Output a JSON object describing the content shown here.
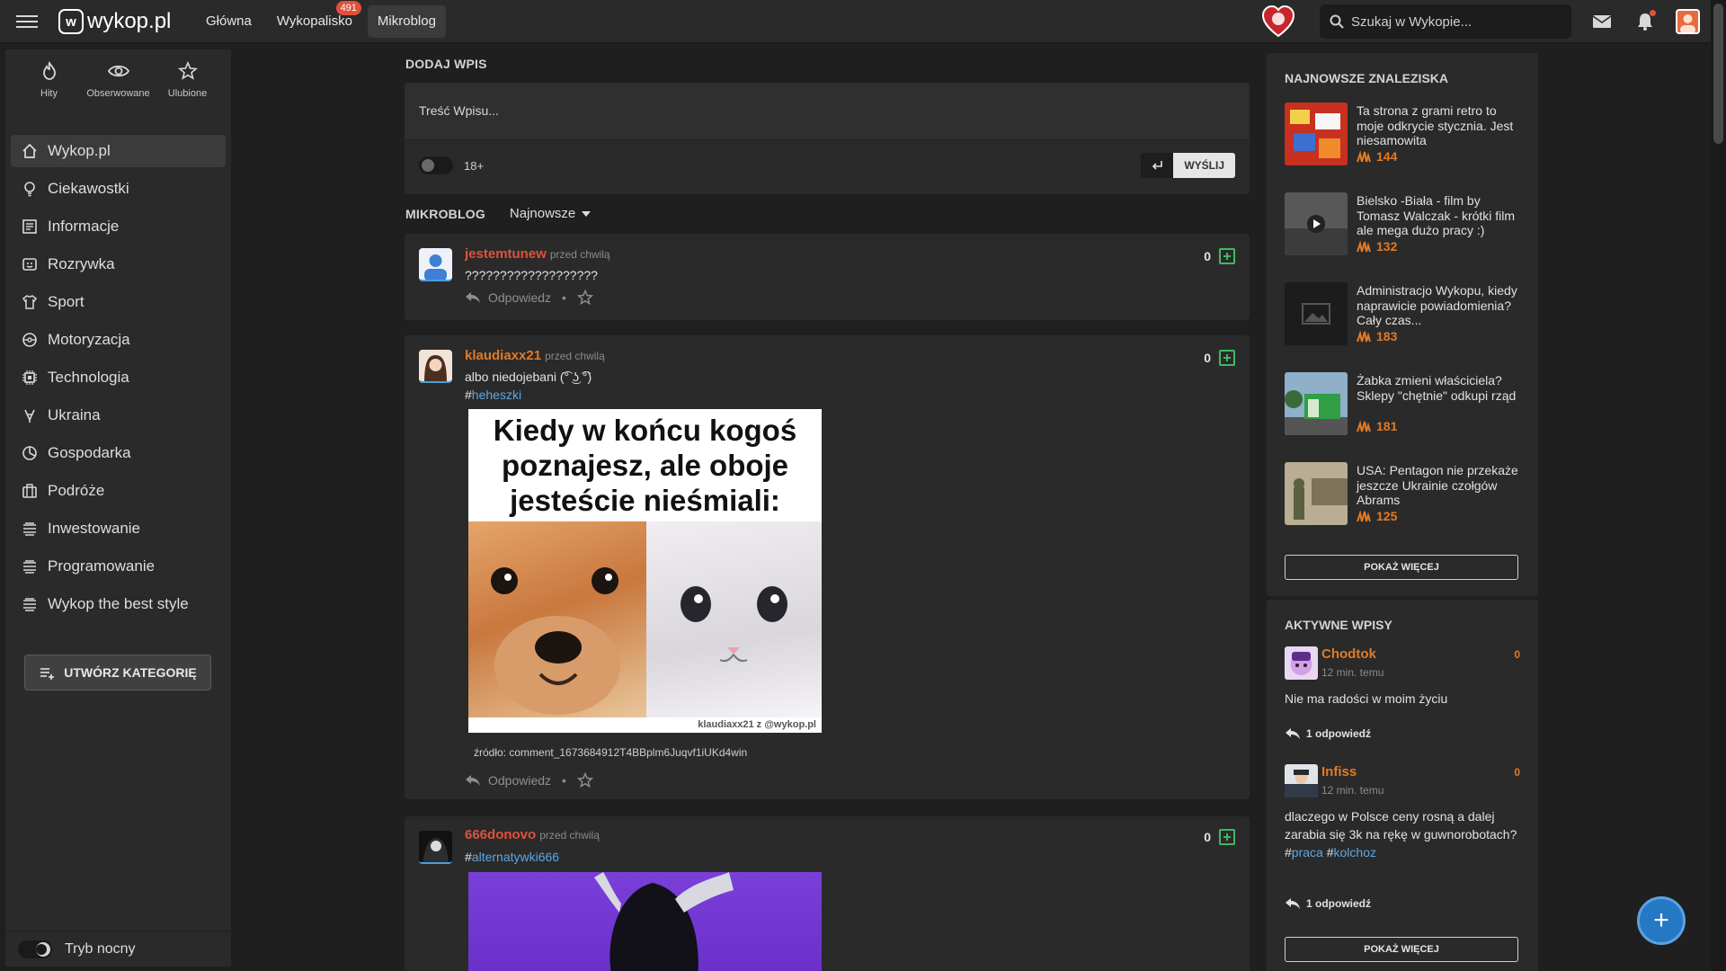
{
  "topbar": {
    "logo": "wykop.pl",
    "nav": [
      {
        "label": "Główna"
      },
      {
        "label": "Wykopalisko",
        "badge": "491"
      },
      {
        "label": "Mikroblog"
      }
    ],
    "search_placeholder": "Szukaj w Wykopie..."
  },
  "sidebar": {
    "quick": [
      {
        "label": "Hity",
        "icon": "flame-icon"
      },
      {
        "label": "Obserwowane",
        "icon": "eye-icon"
      },
      {
        "label": "Ulubione",
        "icon": "star-icon"
      }
    ],
    "categories": [
      {
        "label": "Wykop.pl",
        "icon": "home-icon"
      },
      {
        "label": "Ciekawostki",
        "icon": "lightbulb-icon"
      },
      {
        "label": "Informacje",
        "icon": "newspaper-icon"
      },
      {
        "label": "Rozrywka",
        "icon": "theater-icon"
      },
      {
        "label": "Sport",
        "icon": "shirt-icon"
      },
      {
        "label": "Motoryzacja",
        "icon": "steering-wheel-icon"
      },
      {
        "label": "Technologia",
        "icon": "chip-icon"
      },
      {
        "label": "Ukraina",
        "icon": "ukraine-icon"
      },
      {
        "label": "Gospodarka",
        "icon": "chart-icon"
      },
      {
        "label": "Podróże",
        "icon": "suitcase-icon"
      },
      {
        "label": "Inwestowanie",
        "icon": "stack-icon"
      },
      {
        "label": "Programowanie",
        "icon": "stack-icon"
      },
      {
        "label": "Wykop the best style",
        "icon": "stack-icon"
      }
    ],
    "create_label": "UTWÓRZ KATEGORIĘ",
    "night_label": "Tryb nocny"
  },
  "compose": {
    "heading": "DODAJ WPIS",
    "placeholder": "Treść Wpisu...",
    "age_label": "18+",
    "send_label": "WYŚLIJ"
  },
  "feed": {
    "heading": "MIKROBLOG",
    "sort_label": "Najnowsze",
    "reply_label": "Odpowiedz",
    "entries": [
      {
        "author": "jestemtunew",
        "time": "przed chwilą",
        "votes": "0",
        "text": "???????????????????"
      },
      {
        "author": "klaudiaxx21",
        "time": "przed chwilą",
        "votes": "0",
        "text": "albo niedojebani (͡° ͜ʖ ͡°)",
        "tag_prefix": "#",
        "tag": "heheszki",
        "meme_text": "Kiedy w końcu kogoś poznajesz, ale oboje jesteście nieśmiali:",
        "meme_footer": "klaudiaxx21 z @wykop.pl",
        "source": "źródło: comment_1673684912T4BBplm6Juqvf1iUKd4win"
      },
      {
        "author": "666donovo",
        "time": "przed chwilą",
        "votes": "0",
        "tag_prefix": "#",
        "tag": "alternatywki666"
      }
    ]
  },
  "right": {
    "finds_heading": "NAJNOWSZE ZNALEZISKA",
    "finds": [
      {
        "title": "Ta strona z grami retro to moje odkrycie stycznia. Jest niesamowita",
        "count": "144"
      },
      {
        "title": "Bielsko -Biała - film by Tomasz Walczak - krótki film ale mega dużo pracy :)",
        "count": "132"
      },
      {
        "title": "Administracjo Wykopu, kiedy naprawicie powiadomienia? Cały czas...",
        "count": "183"
      },
      {
        "title": "Żabka zmieni właściciela? Sklepy \"chętnie\" odkupi rząd",
        "count": "181"
      },
      {
        "title": "USA: Pentagon nie przekaże jeszcze Ukrainie czołgów Abrams",
        "count": "125"
      }
    ],
    "more_label": "POKAŻ WIĘCEJ",
    "active_heading": "AKTYWNE WPISY",
    "active": [
      {
        "author": "Chodtok",
        "time": "12 min. temu",
        "votes": "0",
        "text": "Nie ma radości w moim życiu",
        "replies": "1 odpowiedź"
      },
      {
        "author": "Infiss",
        "time": "12 min. temu",
        "votes": "0",
        "text": "dlaczego w Polsce ceny rosną a dalej zarabia się 3k na rękę w guwnorobotach?",
        "tags": [
          "praca",
          "kolchoz"
        ],
        "replies": "1 odpowiedź"
      }
    ],
    "more_label_2": "POKAŻ WIĘCEJ"
  },
  "fab_label": "+"
}
